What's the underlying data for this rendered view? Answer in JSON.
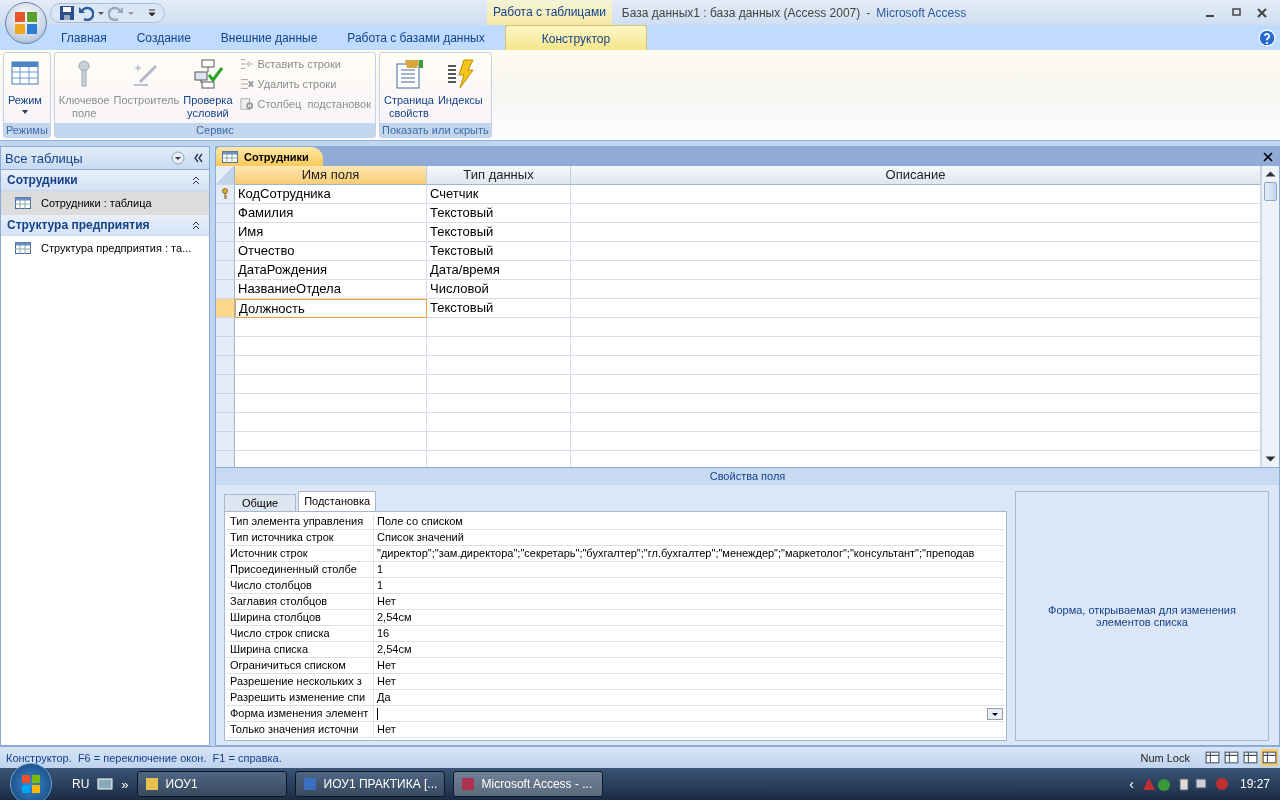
{
  "title_bar": {
    "contextual_tab": "Работа с таблицами",
    "document": "База данных1 : база данных (Access 2007)",
    "separator": "-",
    "app": "Microsoft Access"
  },
  "ribbon_tabs": [
    {
      "label": "Главная",
      "selected": false
    },
    {
      "label": "Создание",
      "selected": false
    },
    {
      "label": "Внешние данные",
      "selected": false
    },
    {
      "label": "Работа с базами данных",
      "selected": false
    },
    {
      "label": "Конструктор",
      "selected": true
    }
  ],
  "ribbon_groups": [
    {
      "label": "Режимы",
      "buttons": [
        {
          "kind": "large",
          "label": "Режим",
          "disabled": false,
          "dropdown": true
        }
      ]
    },
    {
      "label": "Сервис",
      "buttons": [
        {
          "kind": "large",
          "label": "Ключевое\nполе",
          "disabled": true
        },
        {
          "kind": "large",
          "label": "Построитель",
          "disabled": true
        },
        {
          "kind": "large",
          "label": "Проверка\nусловий",
          "disabled": false
        },
        {
          "kind": "small",
          "label": "Вставить строки",
          "disabled": true
        },
        {
          "kind": "small",
          "label": "Удалить строки",
          "disabled": true
        },
        {
          "kind": "small",
          "label": "Столбец  подстановок",
          "disabled": true
        }
      ]
    },
    {
      "label": "Показать или скрыть",
      "buttons": [
        {
          "kind": "large",
          "label": "Страница\nсвойств",
          "disabled": false
        },
        {
          "kind": "large",
          "label": "Индексы",
          "disabled": false
        }
      ]
    }
  ],
  "nav_pane": {
    "title": "Все таблицы",
    "groups": [
      {
        "label": "Сотрудники",
        "items": [
          {
            "label": "Сотрудники : таблица",
            "selected": true
          }
        ]
      },
      {
        "label": "Структура предприятия",
        "items": [
          {
            "label": "Структура предприятия : та...",
            "selected": false
          }
        ]
      }
    ]
  },
  "document_tab": {
    "label": "Сотрудники"
  },
  "design_grid": {
    "columns": [
      "Имя поля",
      "Тип данных",
      "Описание"
    ],
    "rows": [
      {
        "name": "КодСотрудника",
        "type": "Счетчик",
        "primary_key": true,
        "selected": false
      },
      {
        "name": "Фамилия",
        "type": "Текстовый",
        "primary_key": false,
        "selected": false
      },
      {
        "name": "Имя",
        "type": "Текстовый",
        "primary_key": false,
        "selected": false
      },
      {
        "name": "Отчество",
        "type": "Текстовый",
        "primary_key": false,
        "selected": false
      },
      {
        "name": "ДатаРождения",
        "type": "Дата/время",
        "primary_key": false,
        "selected": false
      },
      {
        "name": "НазваниеОтдела",
        "type": "Числовой",
        "primary_key": false,
        "selected": false
      },
      {
        "name": "Должность",
        "type": "Текстовый",
        "primary_key": false,
        "selected": true
      }
    ]
  },
  "field_properties": {
    "title": "Свойства поля",
    "tabs": [
      {
        "label": "Общие",
        "selected": false
      },
      {
        "label": "Подстановка",
        "selected": true
      }
    ],
    "rows": [
      {
        "label": "Тип элемента управления",
        "value": "Поле со списком"
      },
      {
        "label": "Тип источника строк",
        "value": "Список значений"
      },
      {
        "label": "Источник строк",
        "value": "\"директор\";\"зам.директора\";\"секретарь\";\"бухгалтер\";\"гл.бухгалтер\";\"менеждер\";\"маркетолог\";\"консультант\";\"преподав"
      },
      {
        "label": "Присоединенный столбе",
        "value": "1"
      },
      {
        "label": "Число столбцов",
        "value": "1"
      },
      {
        "label": "Заглавия столбцов",
        "value": "Нет"
      },
      {
        "label": "Ширина столбцов",
        "value": "2,54см"
      },
      {
        "label": "Число строк списка",
        "value": "16"
      },
      {
        "label": "Ширина списка",
        "value": "2,54см"
      },
      {
        "label": "Ограничиться списком",
        "value": "Нет"
      },
      {
        "label": "Разрешение нескольких з",
        "value": "Нет"
      },
      {
        "label": "Разрешить изменение спи",
        "value": "Да"
      },
      {
        "label": "Форма изменения элемент",
        "kind": "dropdown",
        "selected": true
      },
      {
        "label": "Только значения источни",
        "value": "Нет"
      }
    ],
    "help": "Форма, открываемая для изменения элементов списка"
  },
  "status_bar": {
    "text": "Конструктор.  F6 = переключение окон.  F1 = справка.",
    "indicator": "Num Lock",
    "views": [
      {
        "selected": false
      },
      {
        "selected": false
      },
      {
        "selected": false
      },
      {
        "selected": true
      }
    ]
  },
  "taskbar": {
    "language": "RU",
    "overflow": "»",
    "buttons": [
      {
        "label": "ИОУ1",
        "selected": false
      },
      {
        "label": "ИОУ1 ПРАКТИКА [...",
        "selected": false
      },
      {
        "label": "Microsoft Access - ...",
        "selected": true
      }
    ],
    "tray_chevron": "‹",
    "clock": "19:27"
  }
}
